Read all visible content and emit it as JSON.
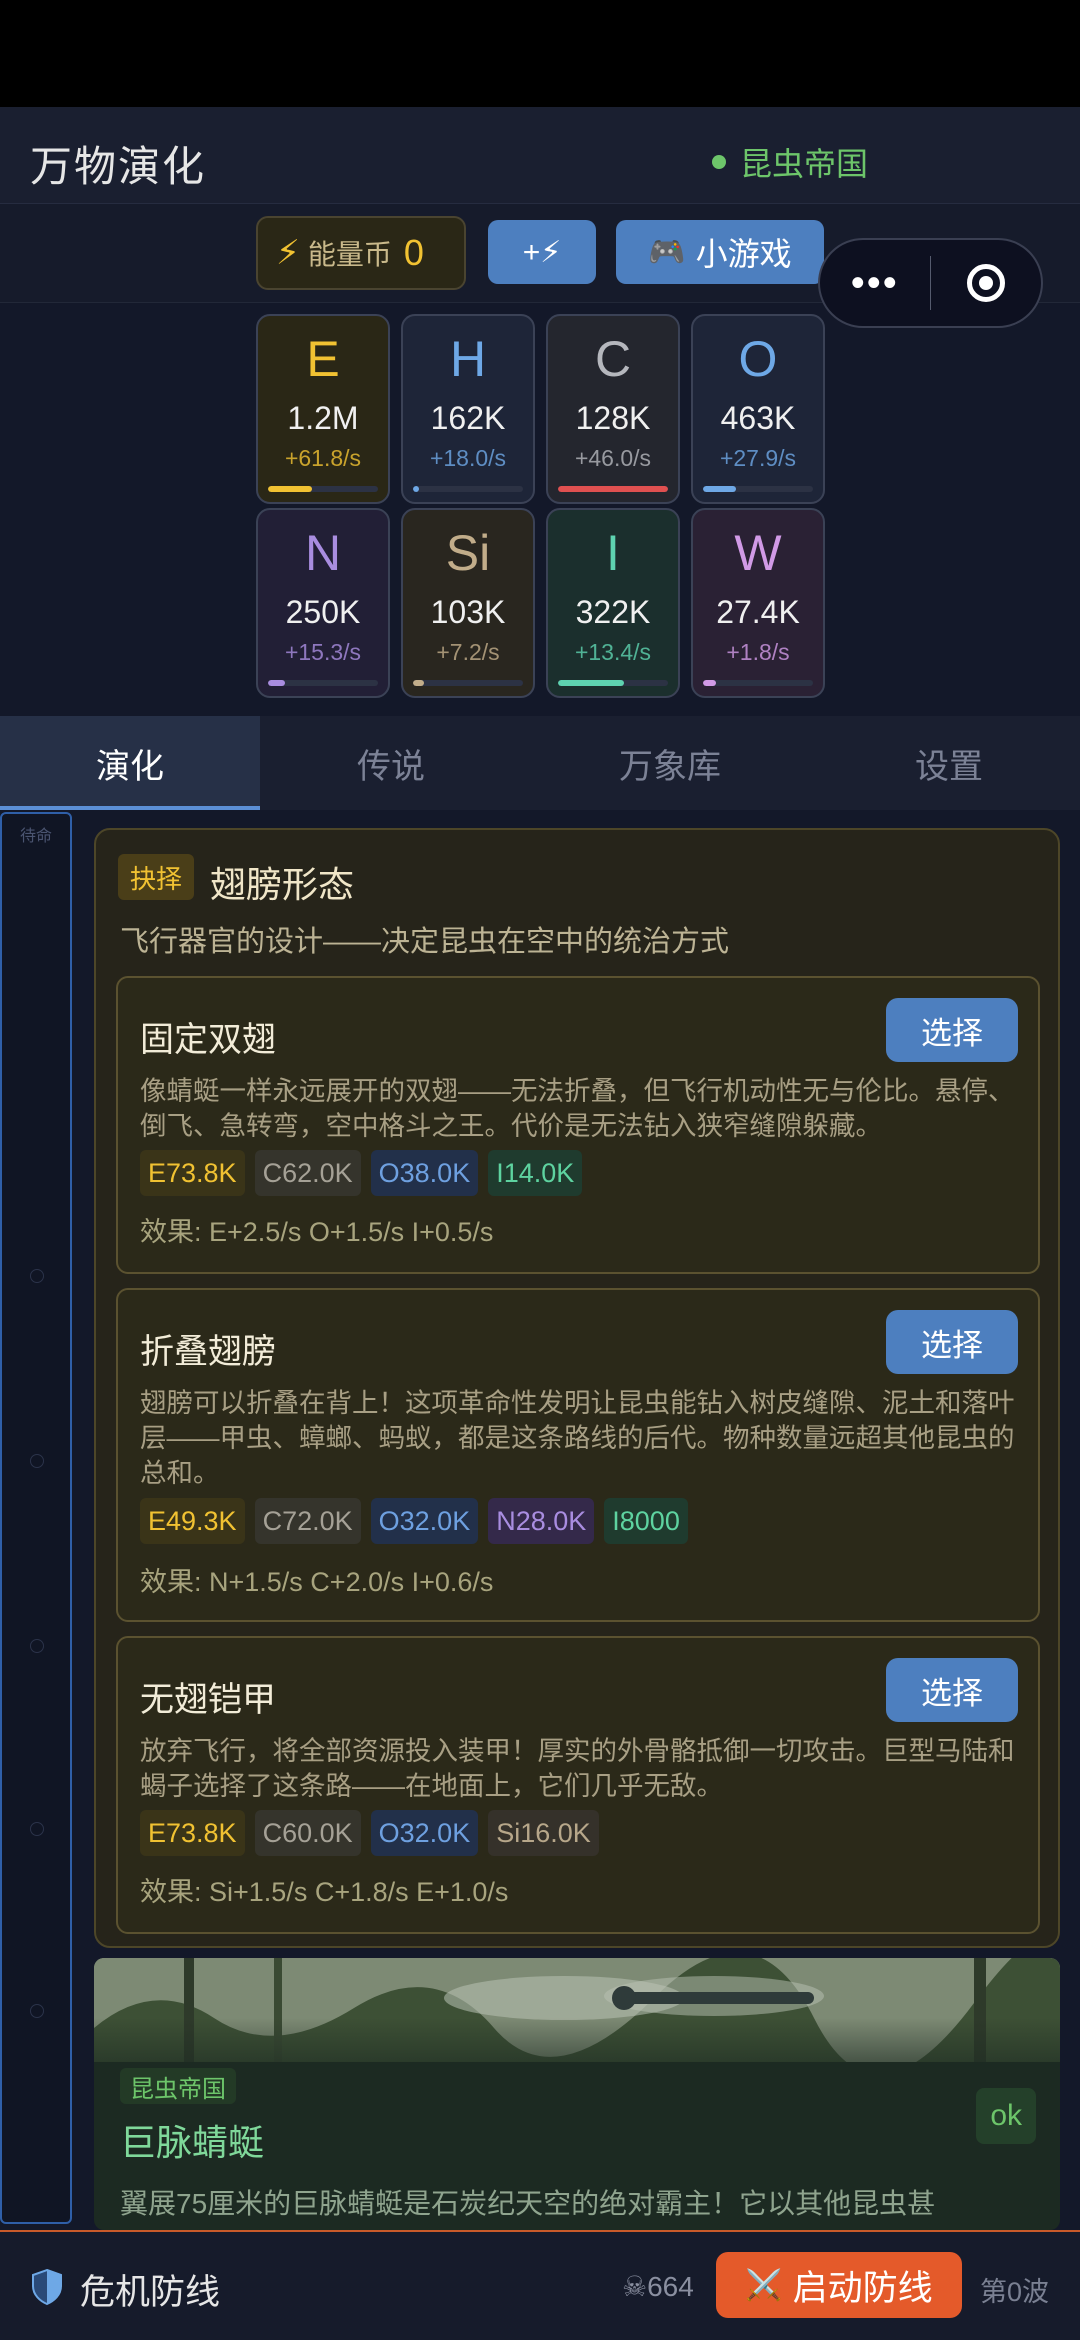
{
  "header": {
    "title": "万物演化",
    "empire": "昆虫帝国"
  },
  "topbar": {
    "energy_label": "能量币",
    "energy_value": "0",
    "plus_label": "+⚡",
    "minigame_label": "小游戏"
  },
  "resources": [
    {
      "symbol": "E",
      "amount": "1.2M",
      "rate": "+61.8/s",
      "color": "#f1c232",
      "bg": "#2a2716",
      "bar": 0.4
    },
    {
      "symbol": "H",
      "amount": "162K",
      "rate": "+18.0/s",
      "color": "#6ea8e6",
      "bg": "#1e2538",
      "bar": 0.05
    },
    {
      "symbol": "C",
      "amount": "128K",
      "rate": "+46.0/s",
      "color": "#b5b7bd",
      "bg": "#24262e",
      "bar": 1.0
    },
    {
      "symbol": "O",
      "amount": "463K",
      "rate": "+27.9/s",
      "color": "#6ea8e6",
      "bg": "#1e2538",
      "bar": 0.3
    },
    {
      "symbol": "N",
      "amount": "250K",
      "rate": "+15.3/s",
      "color": "#a98de0",
      "bg": "#221f36",
      "bar": 0.15
    },
    {
      "symbol": "Si",
      "amount": "103K",
      "rate": "+7.2/s",
      "color": "#c2ad8a",
      "bg": "#29261f",
      "bar": 0.1
    },
    {
      "symbol": "I",
      "amount": "322K",
      "rate": "+13.4/s",
      "color": "#5ed3b0",
      "bg": "#1b2f2d",
      "bar": 0.6
    },
    {
      "symbol": "W",
      "amount": "27.4K",
      "rate": "+1.8/s",
      "color": "#d19ae6",
      "bg": "#2a2134",
      "bar": 0.12
    }
  ],
  "tabs": [
    "演化",
    "传说",
    "万象库",
    "设置"
  ],
  "side_rail": {
    "label": "待命"
  },
  "choice": {
    "tag": "抉择",
    "title": "翅膀形态",
    "subtitle": "飞行器官的设计——决定昆虫在空中的统治方式",
    "select_label": "选择",
    "options": [
      {
        "name": "固定双翅",
        "desc": "像蜻蜓一样永远展开的双翅——无法折叠，但飞行机动性无与伦比。悬停、倒飞、急转弯，空中格斗之王。代价是无法钻入狭窄缝隙躲藏。",
        "costs": [
          {
            "t": "E",
            "v": "E73.8K"
          },
          {
            "t": "C",
            "v": "C62.0K"
          },
          {
            "t": "O",
            "v": "O38.0K"
          },
          {
            "t": "I",
            "v": "I14.0K"
          }
        ],
        "effect": "效果: E+2.5/s  O+1.5/s  I+0.5/s"
      },
      {
        "name": "折叠翅膀",
        "desc": "翅膀可以折叠在背上！这项革命性发明让昆虫能钻入树皮缝隙、泥土和落叶层——甲虫、蟑螂、蚂蚁，都是这条路线的后代。物种数量远超其他昆虫的总和。",
        "costs": [
          {
            "t": "E",
            "v": "E49.3K"
          },
          {
            "t": "C",
            "v": "C72.0K"
          },
          {
            "t": "O",
            "v": "O32.0K"
          },
          {
            "t": "N",
            "v": "N28.0K"
          },
          {
            "t": "I",
            "v": "I8000"
          }
        ],
        "effect": "效果: N+1.5/s  C+2.0/s  I+0.6/s"
      },
      {
        "name": "无翅铠甲",
        "desc": "放弃飞行，将全部资源投入装甲！厚实的外骨骼抵御一切攻击。巨型马陆和蝎子选择了这条路——在地面上，它们几乎无敌。",
        "costs": [
          {
            "t": "E",
            "v": "E73.8K"
          },
          {
            "t": "C",
            "v": "C60.0K"
          },
          {
            "t": "O",
            "v": "O32.0K"
          },
          {
            "t": "Si",
            "v": "Si16.0K"
          }
        ],
        "effect": "效果: Si+1.5/s  C+1.8/s  E+1.0/s"
      }
    ]
  },
  "event": {
    "tag": "昆虫帝国",
    "title": "巨脉蜻蜓",
    "ok": "ok",
    "desc": "翼展75厘米的巨脉蜻蜓是石炭纪天空的绝对霸主！它以其他昆虫甚"
  },
  "bottom": {
    "crisis_label": "危机防线",
    "threat": "☠664",
    "launch_label": "启动防线",
    "wave": "第0波"
  }
}
